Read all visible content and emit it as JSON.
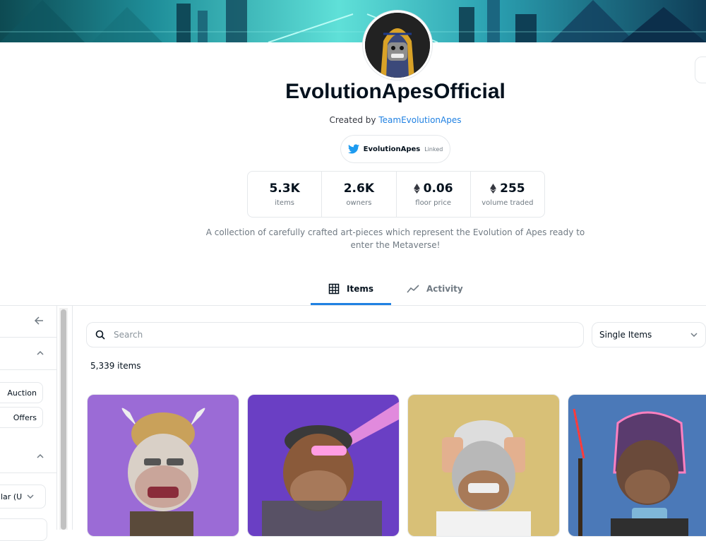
{
  "collection": {
    "name": "EvolutionApesOfficial",
    "created_by_prefix": "Created by",
    "creator": "TeamEvolutionApes",
    "twitter_handle": "EvolutionApes",
    "twitter_status": "Linked",
    "description": "A collection of carefully crafted art-pieces which represent the Evolution of Apes ready to enter the Metaverse!"
  },
  "stats": [
    {
      "value": "5.3K",
      "label": "items",
      "eth": false
    },
    {
      "value": "2.6K",
      "label": "owners",
      "eth": false
    },
    {
      "value": "0.06",
      "label": "floor price",
      "eth": true
    },
    {
      "value": "255",
      "label": "volume traded",
      "eth": true
    }
  ],
  "tabs": {
    "items": "Items",
    "activity": "Activity"
  },
  "sidebar": {
    "buttons": [
      "Auction",
      "Offers"
    ],
    "currency_select": "lar (U"
  },
  "search": {
    "placeholder": "Search"
  },
  "view_select": "Single Items",
  "item_count": "5,339 items",
  "colors": {
    "accent": "#2081e2",
    "twitter": "#1d9bf0",
    "text_primary": "#04111d",
    "text_secondary": "#707a83",
    "border": "#e5e8eb"
  },
  "icons": {
    "twitter": "twitter-bird-icon",
    "eth": "ethereum-icon",
    "grid": "grid-icon",
    "activity": "activity-chart-icon",
    "search": "search-icon",
    "back": "arrow-left-icon",
    "chevron": "chevron-icon"
  }
}
